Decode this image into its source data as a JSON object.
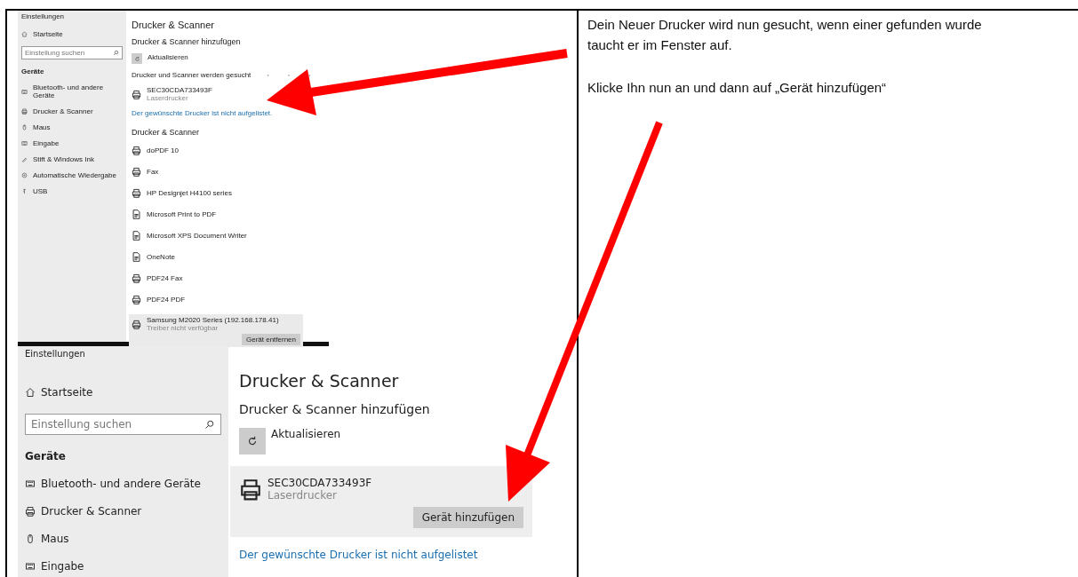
{
  "top_screenshot": {
    "window_title": "Einstellungen",
    "sidebar": {
      "home": "Startseite",
      "search_placeholder": "Einstellung suchen",
      "section": "Geräte",
      "items": [
        "Bluetooth- und andere Geräte",
        "Drucker & Scanner",
        "Maus",
        "Eingabe",
        "Stift & Windows Ink",
        "Automatische Wiedergabe",
        "USB"
      ]
    },
    "main": {
      "title": "Drucker & Scanner",
      "add_heading": "Drucker & Scanner hinzufügen",
      "refresh_label": "Aktualisieren",
      "searching_status": "Drucker und Scanner werden gesucht",
      "found_device": {
        "name": "SEC30CDA733493F",
        "type": "Laserdrucker"
      },
      "not_listed_link": "Der gewünschte Drucker ist nicht aufgelistet.",
      "list_heading": "Drucker & Scanner",
      "printers": [
        {
          "name": "doPDF 10",
          "kind": "printer",
          "selected": false
        },
        {
          "name": "Fax",
          "kind": "printer",
          "selected": false
        },
        {
          "name": "HP Designjet H4100 series",
          "kind": "printer",
          "selected": false
        },
        {
          "name": "Microsoft Print to PDF",
          "kind": "document",
          "selected": false
        },
        {
          "name": "Microsoft XPS Document Writer",
          "kind": "document",
          "selected": false
        },
        {
          "name": "OneNote",
          "kind": "document",
          "selected": false
        },
        {
          "name": "PDF24 Fax",
          "kind": "printer",
          "selected": false
        },
        {
          "name": "PDF24 PDF",
          "kind": "printer",
          "selected": false
        },
        {
          "name": "Samsung M2020 Series (192.168.178.41)",
          "kind": "printer",
          "status": "Treiber nicht verfügbar",
          "selected": true
        }
      ],
      "remove_button": "Gerät entfernen"
    }
  },
  "bottom_screenshot": {
    "window_title": "Einstellungen",
    "sidebar": {
      "home": "Startseite",
      "search_placeholder": "Einstellung suchen",
      "section": "Geräte",
      "items": [
        "Bluetooth- und andere Geräte",
        "Drucker & Scanner",
        "Maus",
        "Eingabe"
      ]
    },
    "main": {
      "title": "Drucker & Scanner",
      "add_heading": "Drucker & Scanner hinzufügen",
      "refresh_label": "Aktualisieren",
      "devices": [
        {
          "name": "SEC30CDA733493F",
          "type": "Laserdrucker",
          "selected": true
        }
      ],
      "add_button": "Gerät hinzufügen",
      "not_listed_link": "Der gewünschte Drucker ist nicht aufgelistet"
    }
  },
  "instructions": [
    "Dein Neuer Drucker wird nun gesucht, wenn einer gefunden wurde taucht er im Fenster auf.",
    "Klicke Ihn nun an und dann auf „Gerät hinzufügen“"
  ]
}
